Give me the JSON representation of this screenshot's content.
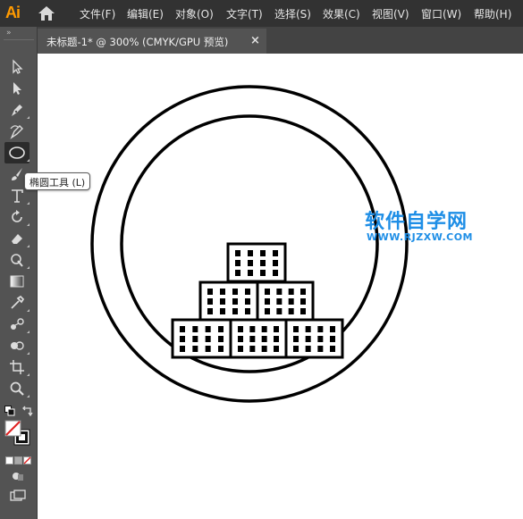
{
  "app": {
    "logo": "Ai"
  },
  "menu": {
    "items": [
      "文件(F)",
      "编辑(E)",
      "对象(O)",
      "文字(T)",
      "选择(S)",
      "效果(C)",
      "视图(V)",
      "窗口(W)",
      "帮助(H)"
    ]
  },
  "document_tab": {
    "title": "未标题-1* @ 300% (CMYK/GPU 预览)",
    "close": "×"
  },
  "toolbar": {
    "grip": "»",
    "tooltip": "椭圆工具 (L)",
    "tools": [
      "selection-tool-icon",
      "direct-selection-tool-icon",
      "pen-tool-icon",
      "curvature-tool-icon",
      "ellipse-tool-icon",
      "paintbrush-tool-icon",
      "type-tool-icon",
      "rotate-tool-icon",
      "eraser-tool-icon",
      "puppet-warp-tool-icon",
      "gradient-tool-icon",
      "eyedropper-tool-icon",
      "blend-tool-icon",
      "shape-builder-tool-icon",
      "artboard-tool-icon",
      "zoom-tool-icon"
    ]
  },
  "watermark": {
    "title": "软件自学网",
    "url": "WWW.RJZXW.COM"
  },
  "colors": {
    "accent": "#ff9a00",
    "watermark": "#1e8ee6",
    "stroke": "#000000"
  }
}
